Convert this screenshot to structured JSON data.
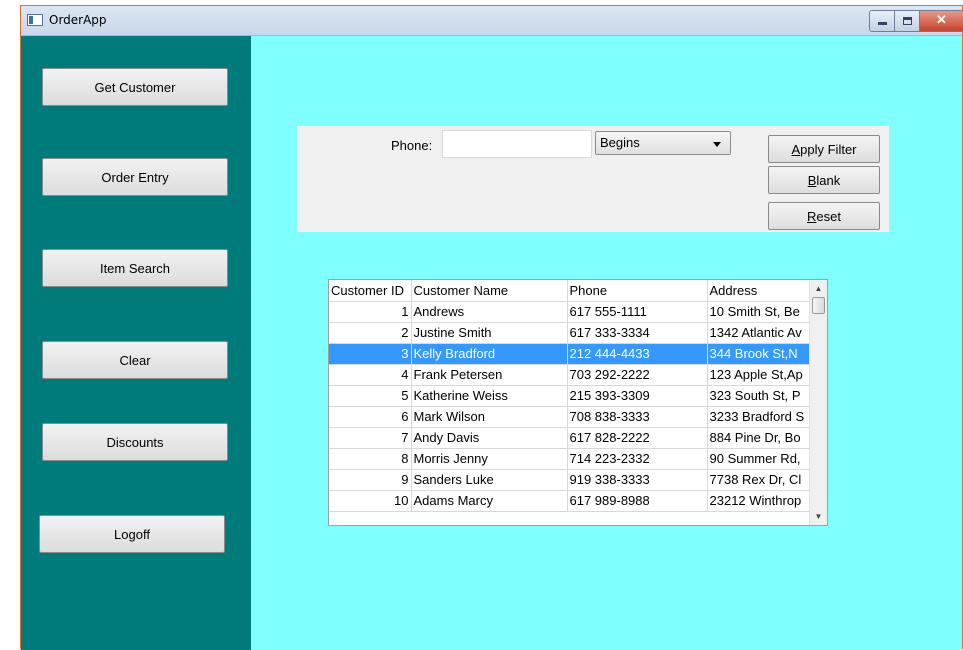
{
  "window": {
    "title": "OrderApp"
  },
  "sidebar": {
    "buttons": [
      "Get Customer",
      "Order Entry",
      "Item Search",
      "Clear",
      "Discounts",
      "Logoff"
    ]
  },
  "filter": {
    "phone_label": "Phone:",
    "phone_value": "",
    "match_mode": "Begins",
    "apply_label": "Apply Filter",
    "blank_label": "Blank",
    "reset_label": "Reset"
  },
  "grid": {
    "columns": [
      "Customer ID",
      "Customer Name",
      "Phone",
      "Address"
    ],
    "rows": [
      [
        "1",
        "Andrews",
        "617 555-1111",
        "10 Smith St, Be"
      ],
      [
        "2",
        "Justine Smith",
        "617 333-3334",
        "1342 Atlantic Av"
      ],
      [
        "3",
        "Kelly Bradford",
        "212 444-4433",
        "344 Brook St,N"
      ],
      [
        "4",
        "Frank Petersen",
        "703 292-2222",
        "123 Apple St,Ap"
      ],
      [
        "5",
        "Katherine Weiss",
        "215 393-3309",
        "323 South St, P"
      ],
      [
        "6",
        "Mark Wilson",
        "708 838-3333",
        "3233 Bradford S"
      ],
      [
        "7",
        "Andy Davis",
        "617 828-2222",
        "884 Pine Dr, Bo"
      ],
      [
        "8",
        "Morris Jenny",
        "714 223-2332",
        "90 Summer Rd,"
      ],
      [
        "9",
        "Sanders Luke",
        "919 338-3333",
        "7738 Rex Dr, Cl"
      ],
      [
        "10",
        "Adams Marcy",
        "617 989-8988",
        "23212 Winthrop"
      ]
    ],
    "selected_row": 2
  },
  "colors": {
    "sidebar": "#007b7b",
    "content": "#80ffff",
    "selection": "#3399ff"
  }
}
